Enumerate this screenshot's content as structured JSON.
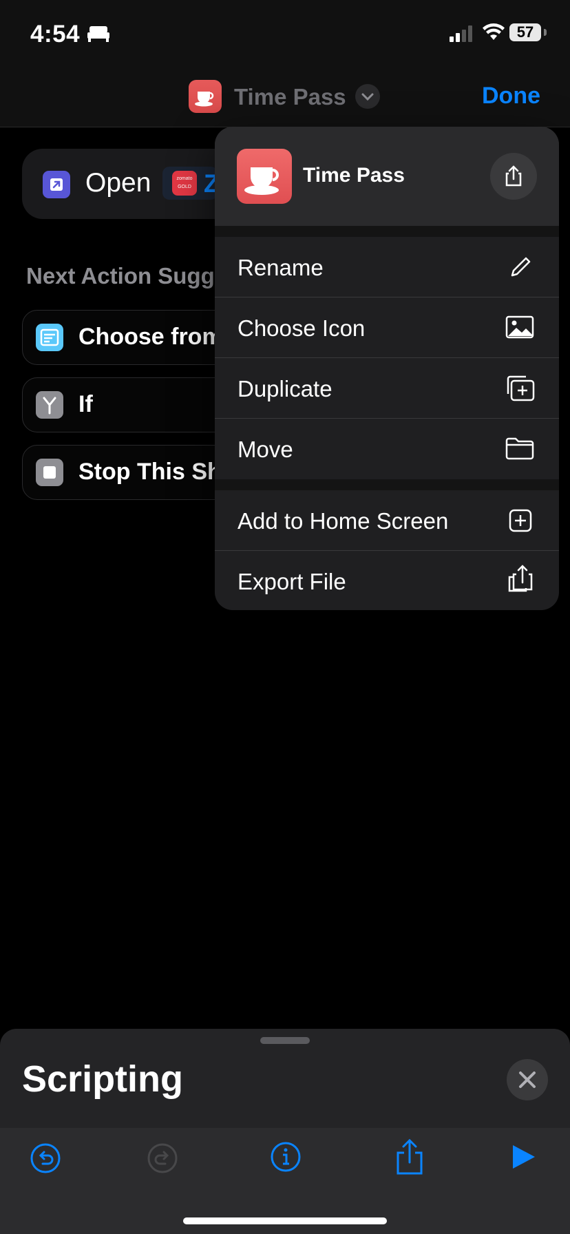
{
  "status_bar": {
    "time": "4:54",
    "battery": "57"
  },
  "nav": {
    "title": "Time Pass",
    "done": "Done"
  },
  "editor": {
    "open_label": "Open",
    "zomato_badge": "zomato",
    "zomato_sub": "GOLD",
    "app_name_fragment": "Z",
    "suggestions_header": "Next Action Sugg",
    "suggestions": [
      "Choose from",
      "If",
      "Stop This Sh"
    ]
  },
  "menu": {
    "header_title": "Time Pass",
    "items": [
      {
        "label": "Rename",
        "icon": "pencil-icon"
      },
      {
        "label": "Choose Icon",
        "icon": "photo-icon"
      },
      {
        "label": "Duplicate",
        "icon": "duplicate-icon"
      },
      {
        "label": "Move",
        "icon": "folder-icon"
      },
      {
        "label": "Add to Home Screen",
        "icon": "plus-square-icon"
      },
      {
        "label": "Export File",
        "icon": "export-icon"
      }
    ]
  },
  "sheet": {
    "title": "Scripting"
  },
  "toolbar": {
    "undo": "undo-icon",
    "redo": "redo-icon",
    "info": "info-icon",
    "share": "share-icon",
    "play": "play-icon"
  },
  "colors": {
    "accent": "#0a84ff",
    "app_icon": "#e65a5a",
    "menu_bg": "#1f1f21"
  }
}
